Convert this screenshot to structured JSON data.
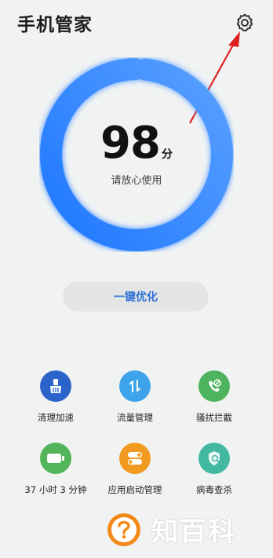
{
  "app": {
    "title": "手机管家"
  },
  "header": {
    "settings_icon": "gear-icon"
  },
  "score": {
    "value": "98",
    "unit": "分",
    "status": "请放心使用",
    "level": 0.98
  },
  "optimize": {
    "label": "一键优化"
  },
  "tools": [
    {
      "label": "清理加速",
      "icon": "broom-icon",
      "color": "#2a63c9"
    },
    {
      "label": "流量管理",
      "icon": "data-arrows-icon",
      "color": "#3da4ec"
    },
    {
      "label": "骚扰拦截",
      "icon": "phone-block-icon",
      "color": "#4db35c"
    },
    {
      "label": "37 小时 3 分钟",
      "icon": "battery-icon",
      "color": "#52b559"
    },
    {
      "label": "应用启动管理",
      "icon": "toggle-icon",
      "color": "#f29a20"
    },
    {
      "label": "病毒查杀",
      "icon": "shield-scan-icon",
      "color": "#42b8a1"
    }
  ],
  "colors": {
    "accent": "#2f6fd6",
    "ring_start": "#1e78ff",
    "ring_end": "#5aa0ff",
    "annotation": "#e02020"
  },
  "watermark": {
    "text": "知百科"
  }
}
